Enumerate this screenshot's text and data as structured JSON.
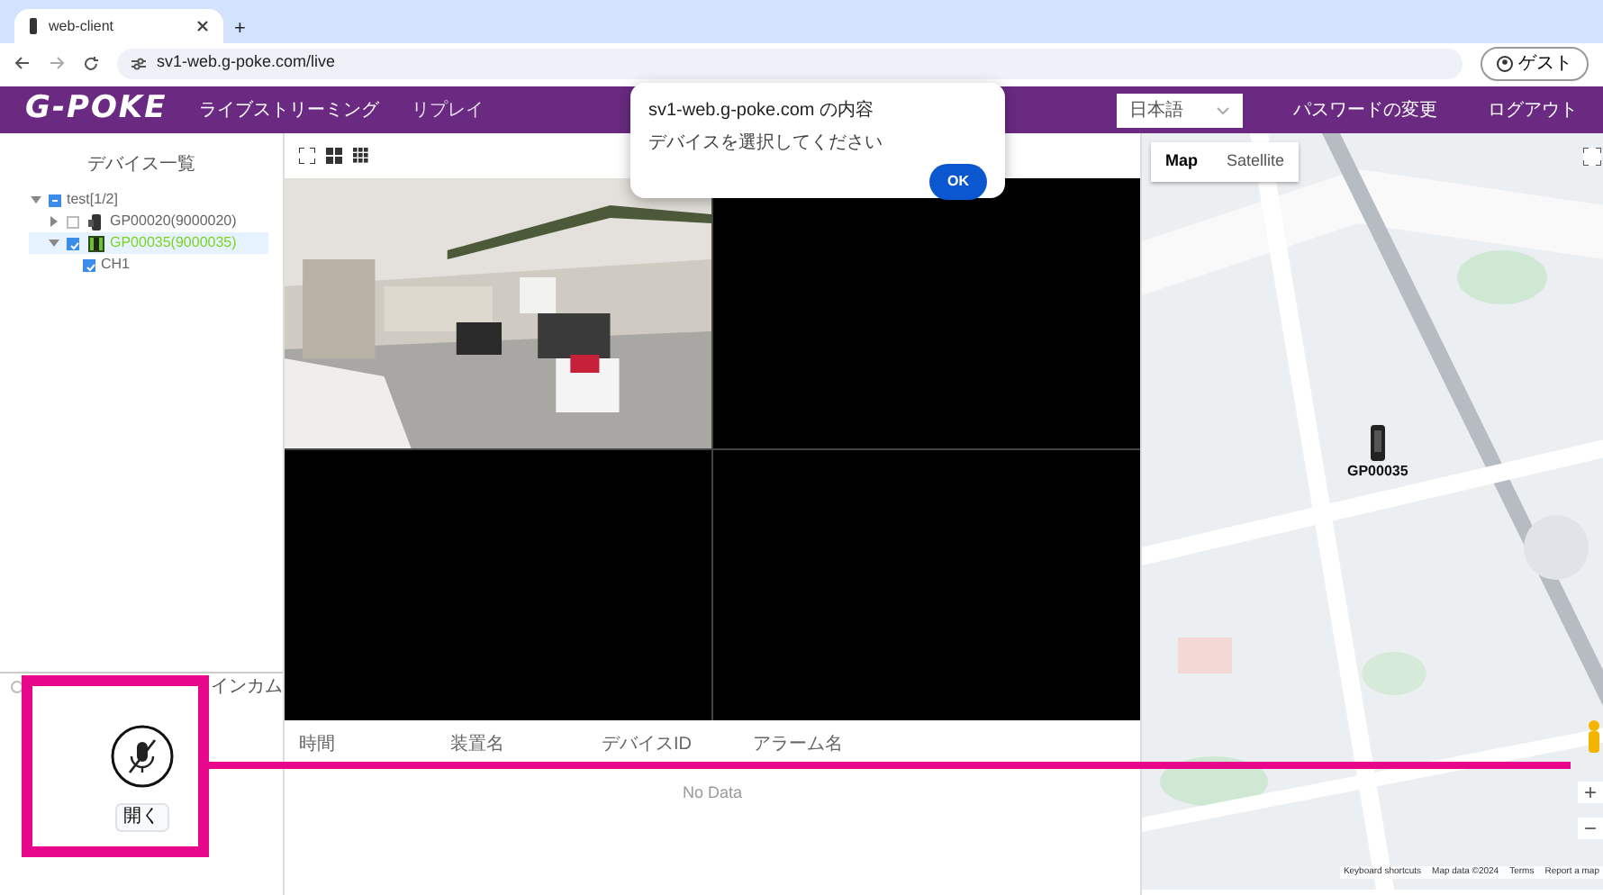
{
  "browser": {
    "tab_title": "web-client",
    "new_tab": "+",
    "url": "sv1-web.g-poke.com/live",
    "profile": "ゲスト"
  },
  "navbar": {
    "logo": "G-POKE",
    "links": [
      {
        "label": "ライブストリーミング",
        "selected": true
      },
      {
        "label": "リプレイ",
        "selected": false
      }
    ],
    "language": "日本語",
    "actions": [
      "パスワードの変更",
      "ログアウト"
    ]
  },
  "sidebar": {
    "title": "デバイス一覧",
    "tree": [
      {
        "label": "test[1/2]",
        "expanded": true,
        "indeterminate": true,
        "selected": false,
        "children": [
          {
            "label": "GP00020(9000020)",
            "online": false,
            "expanded": false,
            "checked": false,
            "selected": false
          },
          {
            "label": "GP00035(9000035)",
            "online": true,
            "expanded": true,
            "checked": true,
            "selected": true,
            "children": [
              {
                "label": "CH1",
                "checked": true,
                "selected": false
              }
            ]
          }
        ]
      }
    ],
    "intercom": {
      "label": "インカム",
      "selected": false,
      "muted": true,
      "open_button": "開く"
    }
  },
  "video": {
    "tiles": [
      {
        "kind": "picture"
      },
      {
        "kind": "empty"
      },
      {
        "kind": "empty"
      },
      {
        "kind": "empty"
      }
    ]
  },
  "alarm_table": {
    "columns": [
      "時間",
      "装置名",
      "デバイスID",
      "アラーム名"
    ],
    "empty_text": "No Data"
  },
  "map": {
    "tabs": [
      {
        "label": "Map",
        "selected": true
      },
      {
        "label": "Satellite",
        "selected": false
      }
    ],
    "marker_label": "GP00035",
    "zoom_in": "+",
    "zoom_out": "−",
    "footer": [
      "Keyboard shortcuts",
      "Map data ©2024",
      "Terms",
      "Report a map"
    ]
  },
  "dialog": {
    "title": "sv1-web.g-poke.com の内容",
    "message": "デバイスを選択してください",
    "button": "OK"
  }
}
